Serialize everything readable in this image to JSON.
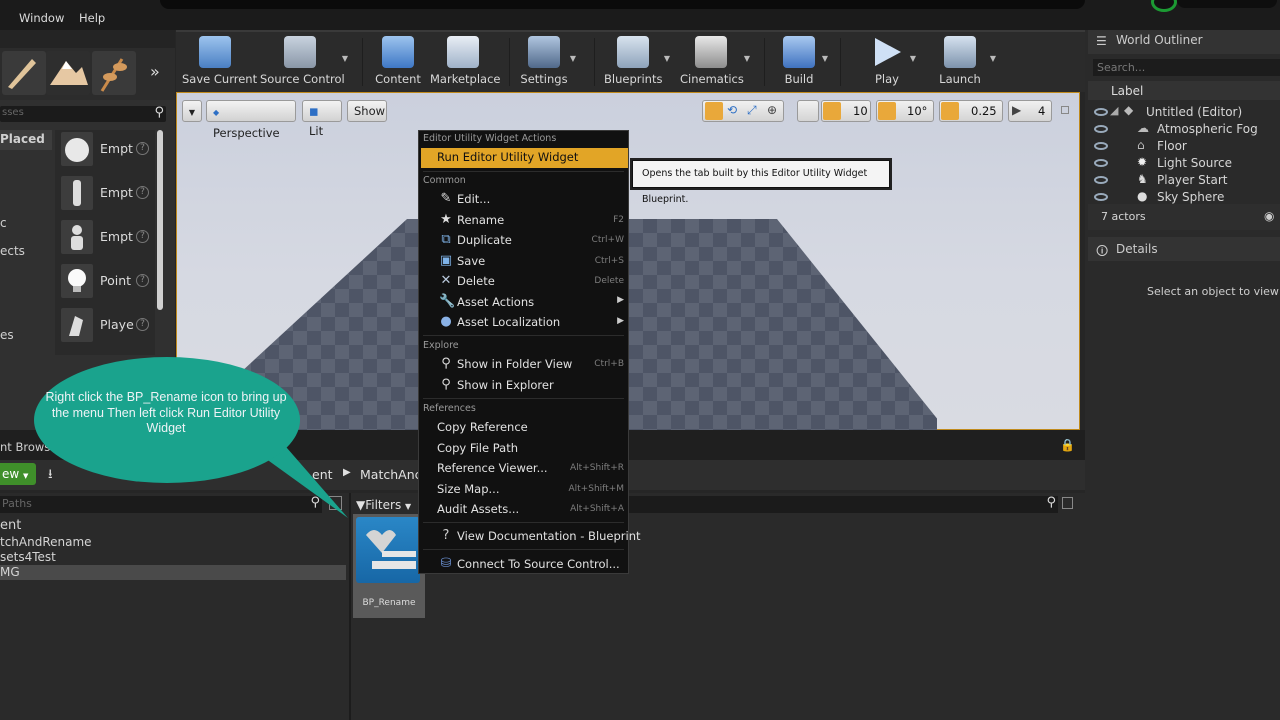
{
  "menu": {
    "window": "Window",
    "help": "Help"
  },
  "toolbar": {
    "save_current": "Save Current",
    "source_control": "Source Control",
    "content": "Content",
    "marketplace": "Marketplace",
    "settings": "Settings",
    "blueprints": "Blueprints",
    "cinematics": "Cinematics",
    "build": "Build",
    "play": "Play",
    "launch": "Launch"
  },
  "place_panel": {
    "search_placeholder": "sses",
    "categories": [
      "Placed",
      "c",
      "ects",
      "es"
    ],
    "items": [
      "Empt",
      "Empt",
      "Empt",
      "Point",
      "Playe"
    ]
  },
  "viewport": {
    "perspective": "Perspective",
    "lit": "Lit",
    "show": "Show",
    "grid_snap": "10",
    "rot_snap": "10°",
    "scale_snap": "0.25",
    "cam_speed": "4"
  },
  "content_browser": {
    "tab": "nt Brows",
    "new": "ew",
    "path_root": "ent",
    "path_folder": "MatchAnc",
    "paths_placeholder": "Paths",
    "filters": "Filters",
    "sources": [
      "ent",
      "tchAndRename",
      "sets4Test",
      "MG"
    ],
    "asset_name": "BP_Rename"
  },
  "context_menu": {
    "section_widget": "Editor Utility Widget Actions",
    "run": "Run Editor Utility Widget",
    "section_common": "Common",
    "edit": "Edit...",
    "rename": "Rename",
    "rename_sc": "F2",
    "duplicate": "Duplicate",
    "duplicate_sc": "Ctrl+W",
    "save": "Save",
    "save_sc": "Ctrl+S",
    "delete": "Delete",
    "delete_sc": "Delete",
    "asset_actions": "Asset Actions",
    "asset_localization": "Asset Localization",
    "section_explore": "Explore",
    "show_folder": "Show in Folder View",
    "show_folder_sc": "Ctrl+B",
    "show_explorer": "Show in Explorer",
    "section_references": "References",
    "copy_ref": "Copy Reference",
    "copy_path": "Copy File Path",
    "ref_viewer": "Reference Viewer...",
    "ref_viewer_sc": "Alt+Shift+R",
    "size_map": "Size Map...",
    "size_map_sc": "Alt+Shift+M",
    "audit": "Audit Assets...",
    "audit_sc": "Alt+Shift+A",
    "view_docs": "View Documentation - Blueprint",
    "connect_sc": "Connect To Source Control..."
  },
  "tooltip": "Opens the tab built by this Editor Utility Widget Blueprint.",
  "callout": "Right click the BP_Rename icon to bring up the menu Then left click Run Editor Utility Widget",
  "world_outliner": {
    "title": "World Outliner",
    "search_placeholder": "Search...",
    "label_col": "Label",
    "rows": [
      "Untitled (Editor)",
      "Atmospheric Fog",
      "Floor",
      "Light Source",
      "Player Start",
      "Sky Sphere"
    ],
    "actor_count": "7 actors"
  },
  "details": {
    "title": "Details",
    "empty": "Select an object to view d"
  },
  "colors": {
    "accent_orange": "#e2a526",
    "callout_teal": "#1aa38d",
    "new_green": "#3f8f2a"
  }
}
